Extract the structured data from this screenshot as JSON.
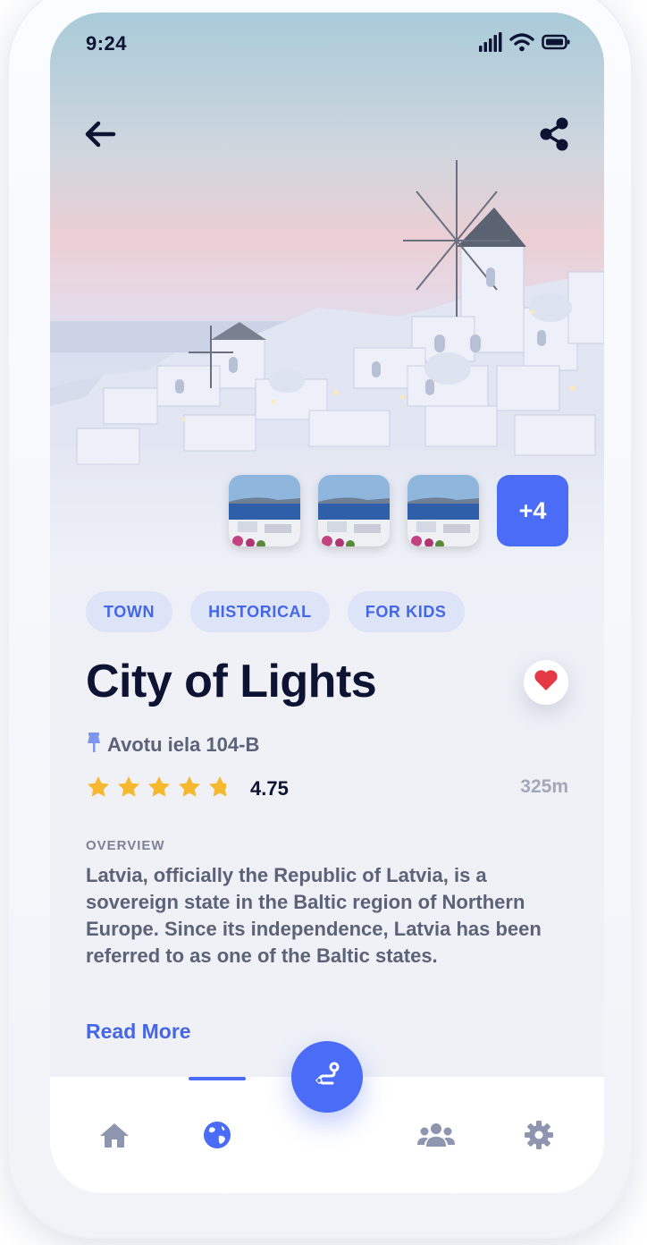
{
  "status_bar": {
    "time": "9:24"
  },
  "gallery": {
    "more_label": "+4"
  },
  "tags": [
    {
      "label": "TOWN"
    },
    {
      "label": "HISTORICAL"
    },
    {
      "label": "FOR KIDS"
    }
  ],
  "place": {
    "title": "City of Lights",
    "address": "Avotu iela 104-B",
    "rating": "4.75",
    "rating_value": 4.75,
    "distance": "325m",
    "favorited": true
  },
  "overview": {
    "label": "OVERVIEW",
    "text": "Latvia, officially the Republic of Latvia, is a sovereign state in the Baltic region of Northern Europe. Since its independence, Latvia has been referred to as one of the Baltic states.",
    "read_more": "Read More"
  },
  "tabbar": {
    "items": [
      "home-icon",
      "globe-icon",
      "route-icon",
      "users-icon",
      "gear-icon"
    ],
    "active": "globe-icon"
  },
  "colors": {
    "accent": "#4a6cf7",
    "title": "#0d1433",
    "heart": "#e63946",
    "star": "#f5b82e"
  }
}
